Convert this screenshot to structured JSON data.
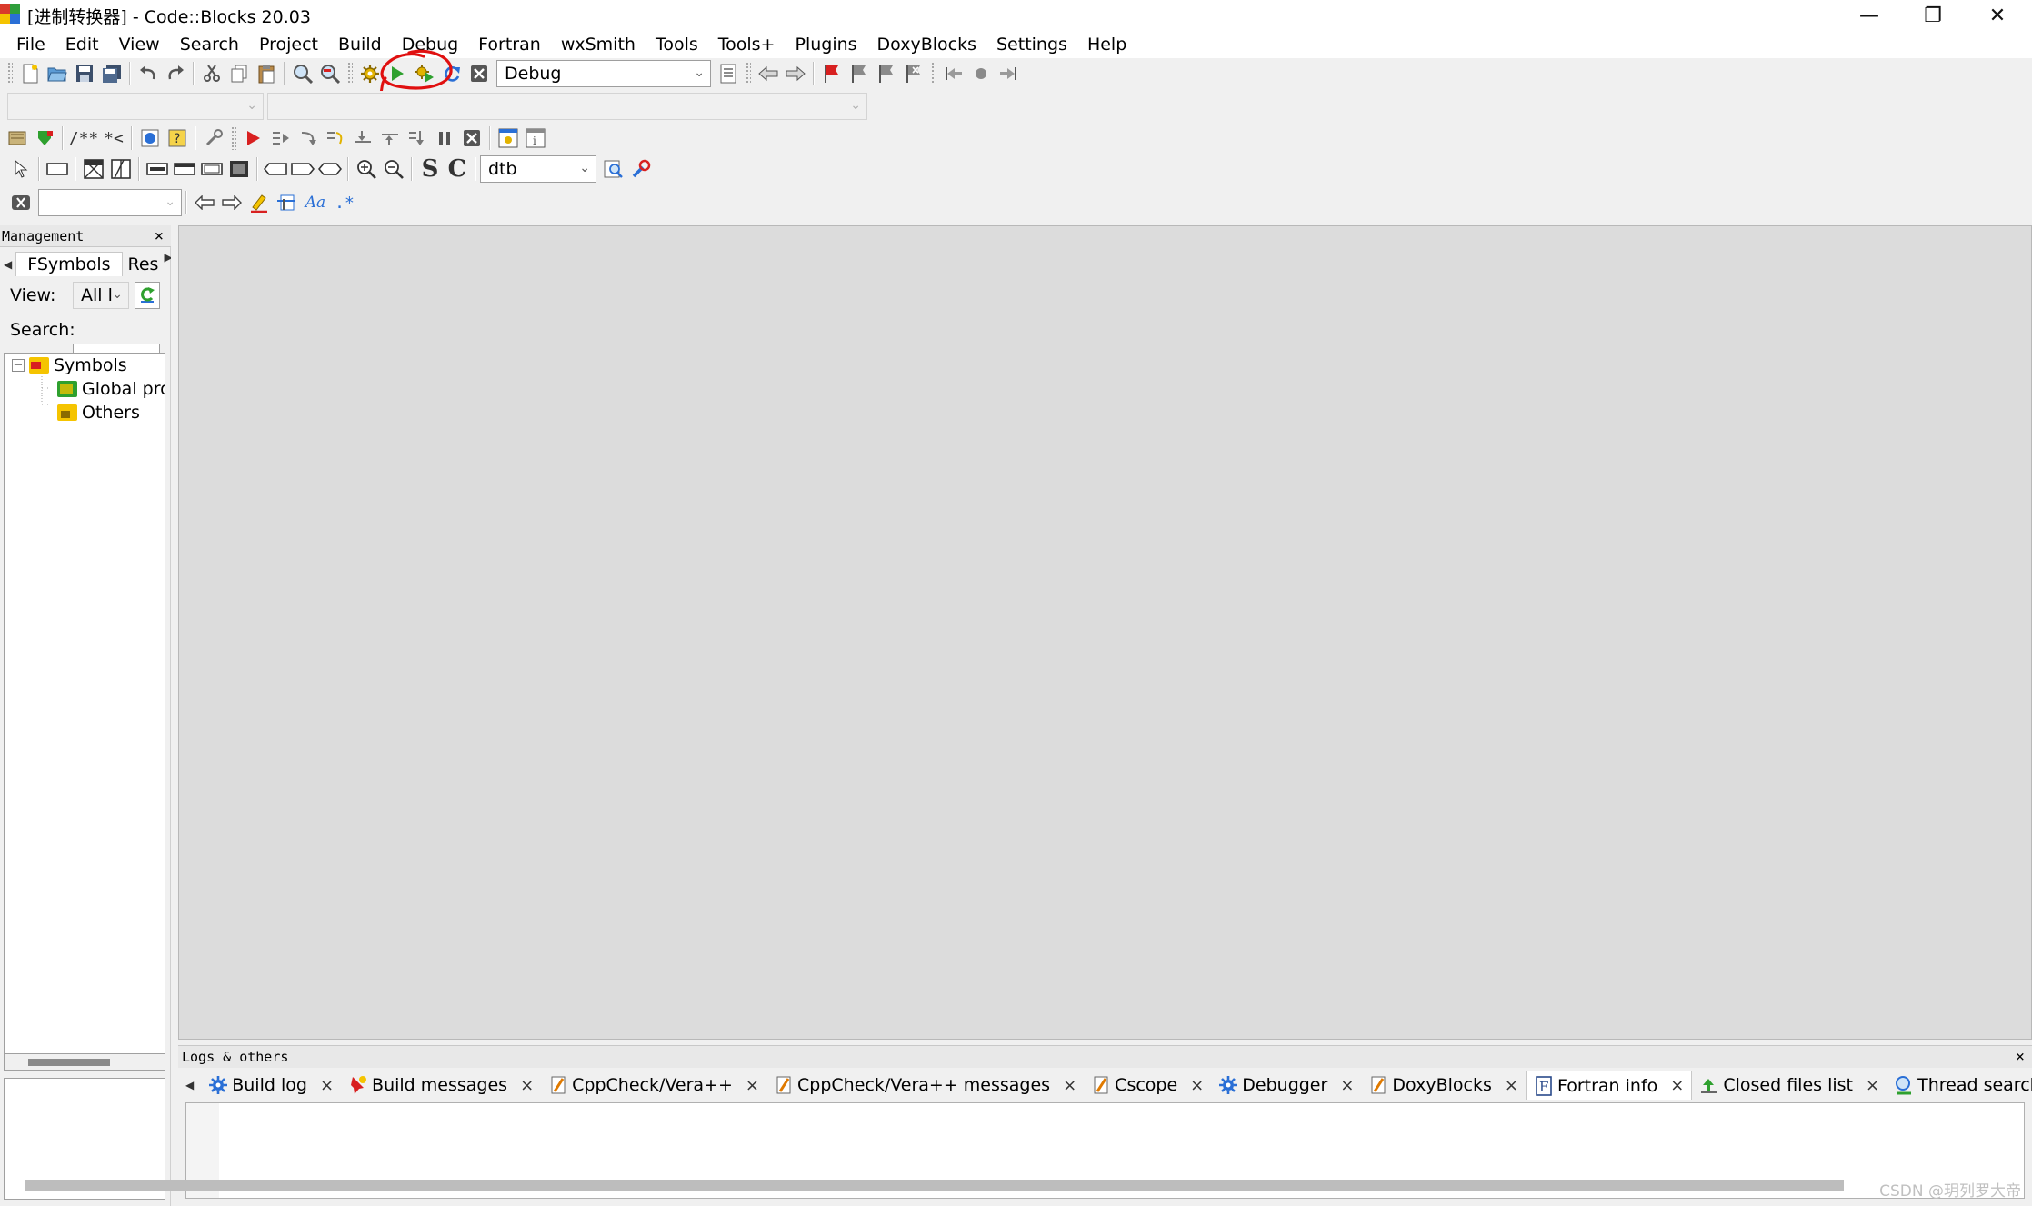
{
  "window": {
    "title": "[进制转换器] - Code::Blocks 20.03",
    "minimize": "—",
    "maximize": "❐",
    "close": "✕"
  },
  "menu": [
    "File",
    "Edit",
    "View",
    "Search",
    "Project",
    "Build",
    "Debug",
    "Fortran",
    "wxSmith",
    "Tools",
    "Tools+",
    "Plugins",
    "DoxyBlocks",
    "Settings",
    "Help"
  ],
  "toolbar": {
    "build_target": "Debug",
    "doxy_comment_block": "/**",
    "doxy_comment_line": "*<",
    "wx_font": "dtb",
    "wx_bold_s": "S",
    "wx_bold_c": "C",
    "search_regex": ".*",
    "search_match_case": "Aa"
  },
  "management": {
    "header": "Management",
    "close": "×",
    "tabs": [
      "FSymbols",
      "Res"
    ],
    "view_label": "View:",
    "view_value": "All l",
    "search_label": "Search:",
    "search_value": "",
    "tree": {
      "root": "Symbols",
      "children": [
        "Global pro",
        "Others"
      ]
    }
  },
  "logs": {
    "header": "Logs & others",
    "close": "×",
    "tabs": [
      {
        "label": "Build log",
        "icon": "gear-icon"
      },
      {
        "label": "Build messages",
        "icon": "pin-icon"
      },
      {
        "label": "CppCheck/Vera++",
        "icon": "pencil-doc-icon"
      },
      {
        "label": "CppCheck/Vera++ messages",
        "icon": "pencil-doc-icon"
      },
      {
        "label": "Cscope",
        "icon": "pencil-doc-icon"
      },
      {
        "label": "Debugger",
        "icon": "gear-icon"
      },
      {
        "label": "DoxyBlocks",
        "icon": "pencil-doc-icon"
      },
      {
        "label": "Fortran info",
        "icon": "fortran-icon"
      },
      {
        "label": "Closed files list",
        "icon": "up-arrow-icon"
      },
      {
        "label": "Thread search",
        "icon": "magnifier-icon"
      }
    ],
    "tab_close": "×"
  },
  "annotation": {
    "color": "#e01010"
  },
  "watermark": "CSDN @玥列罗大帝",
  "colors": {
    "editor_bg": "#dcdcdc",
    "chrome": "#f0f0f0",
    "run_green": "#2ea02e",
    "abort_red": "#d82020"
  }
}
